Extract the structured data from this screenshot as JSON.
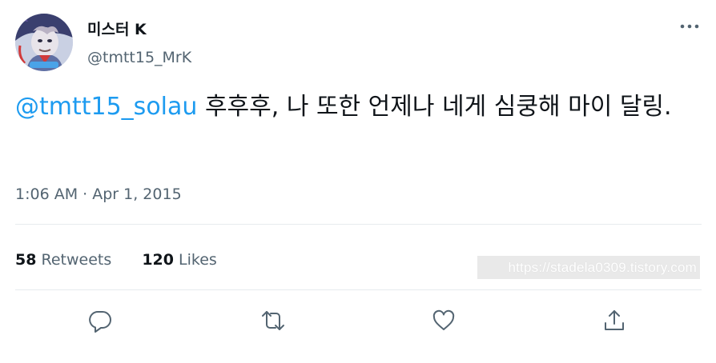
{
  "user": {
    "display_name": "미스터 K",
    "handle": "@tmtt15_MrK"
  },
  "tweet": {
    "mention": "@tmtt15_solau",
    "text": " 후후후, 나 또한 언제나 네게 심쿵해 마이 달링.",
    "time": "1:06 AM",
    "separator": " · ",
    "date": "Apr 1, 2015"
  },
  "stats": {
    "retweets_count": "58",
    "retweets_label": "Retweets",
    "likes_count": "120",
    "likes_label": "Likes"
  },
  "watermark": "https://stadela0309.tistory.com",
  "icons": {
    "more": "more-horizontal-icon",
    "reply": "reply-icon",
    "retweet": "retweet-icon",
    "like": "heart-icon",
    "share": "share-icon"
  },
  "colors": {
    "mention": "#1d9bf0",
    "secondary_text": "#536471",
    "primary_text": "#0f1419",
    "divider": "#e7ebee"
  }
}
